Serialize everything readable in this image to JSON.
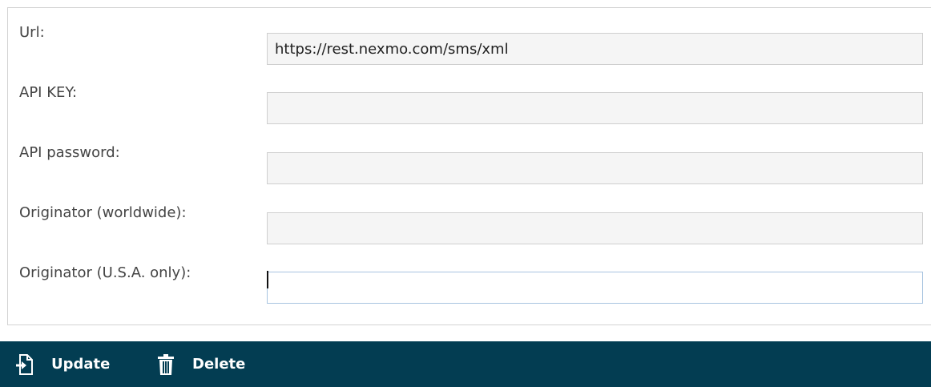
{
  "form": {
    "fields": [
      {
        "label": "Url:",
        "value": "https://rest.nexmo.com/sms/xml",
        "placeholder": ""
      },
      {
        "label": "API KEY:",
        "value": "",
        "placeholder": ""
      },
      {
        "label": "API password:",
        "value": "",
        "placeholder": ""
      },
      {
        "label": "Originator (worldwide):",
        "value": "",
        "placeholder": ""
      },
      {
        "label": "Originator (U.S.A. only):",
        "value": "",
        "placeholder": ""
      }
    ]
  },
  "toolbar": {
    "update_label": "Update",
    "delete_label": "Delete",
    "update_icon": "document-arrow-icon",
    "delete_icon": "trash-icon"
  },
  "colors": {
    "toolbar_bg": "#033d52",
    "field_bg": "#f5f5f5",
    "focused_border": "#a8c4e0"
  }
}
